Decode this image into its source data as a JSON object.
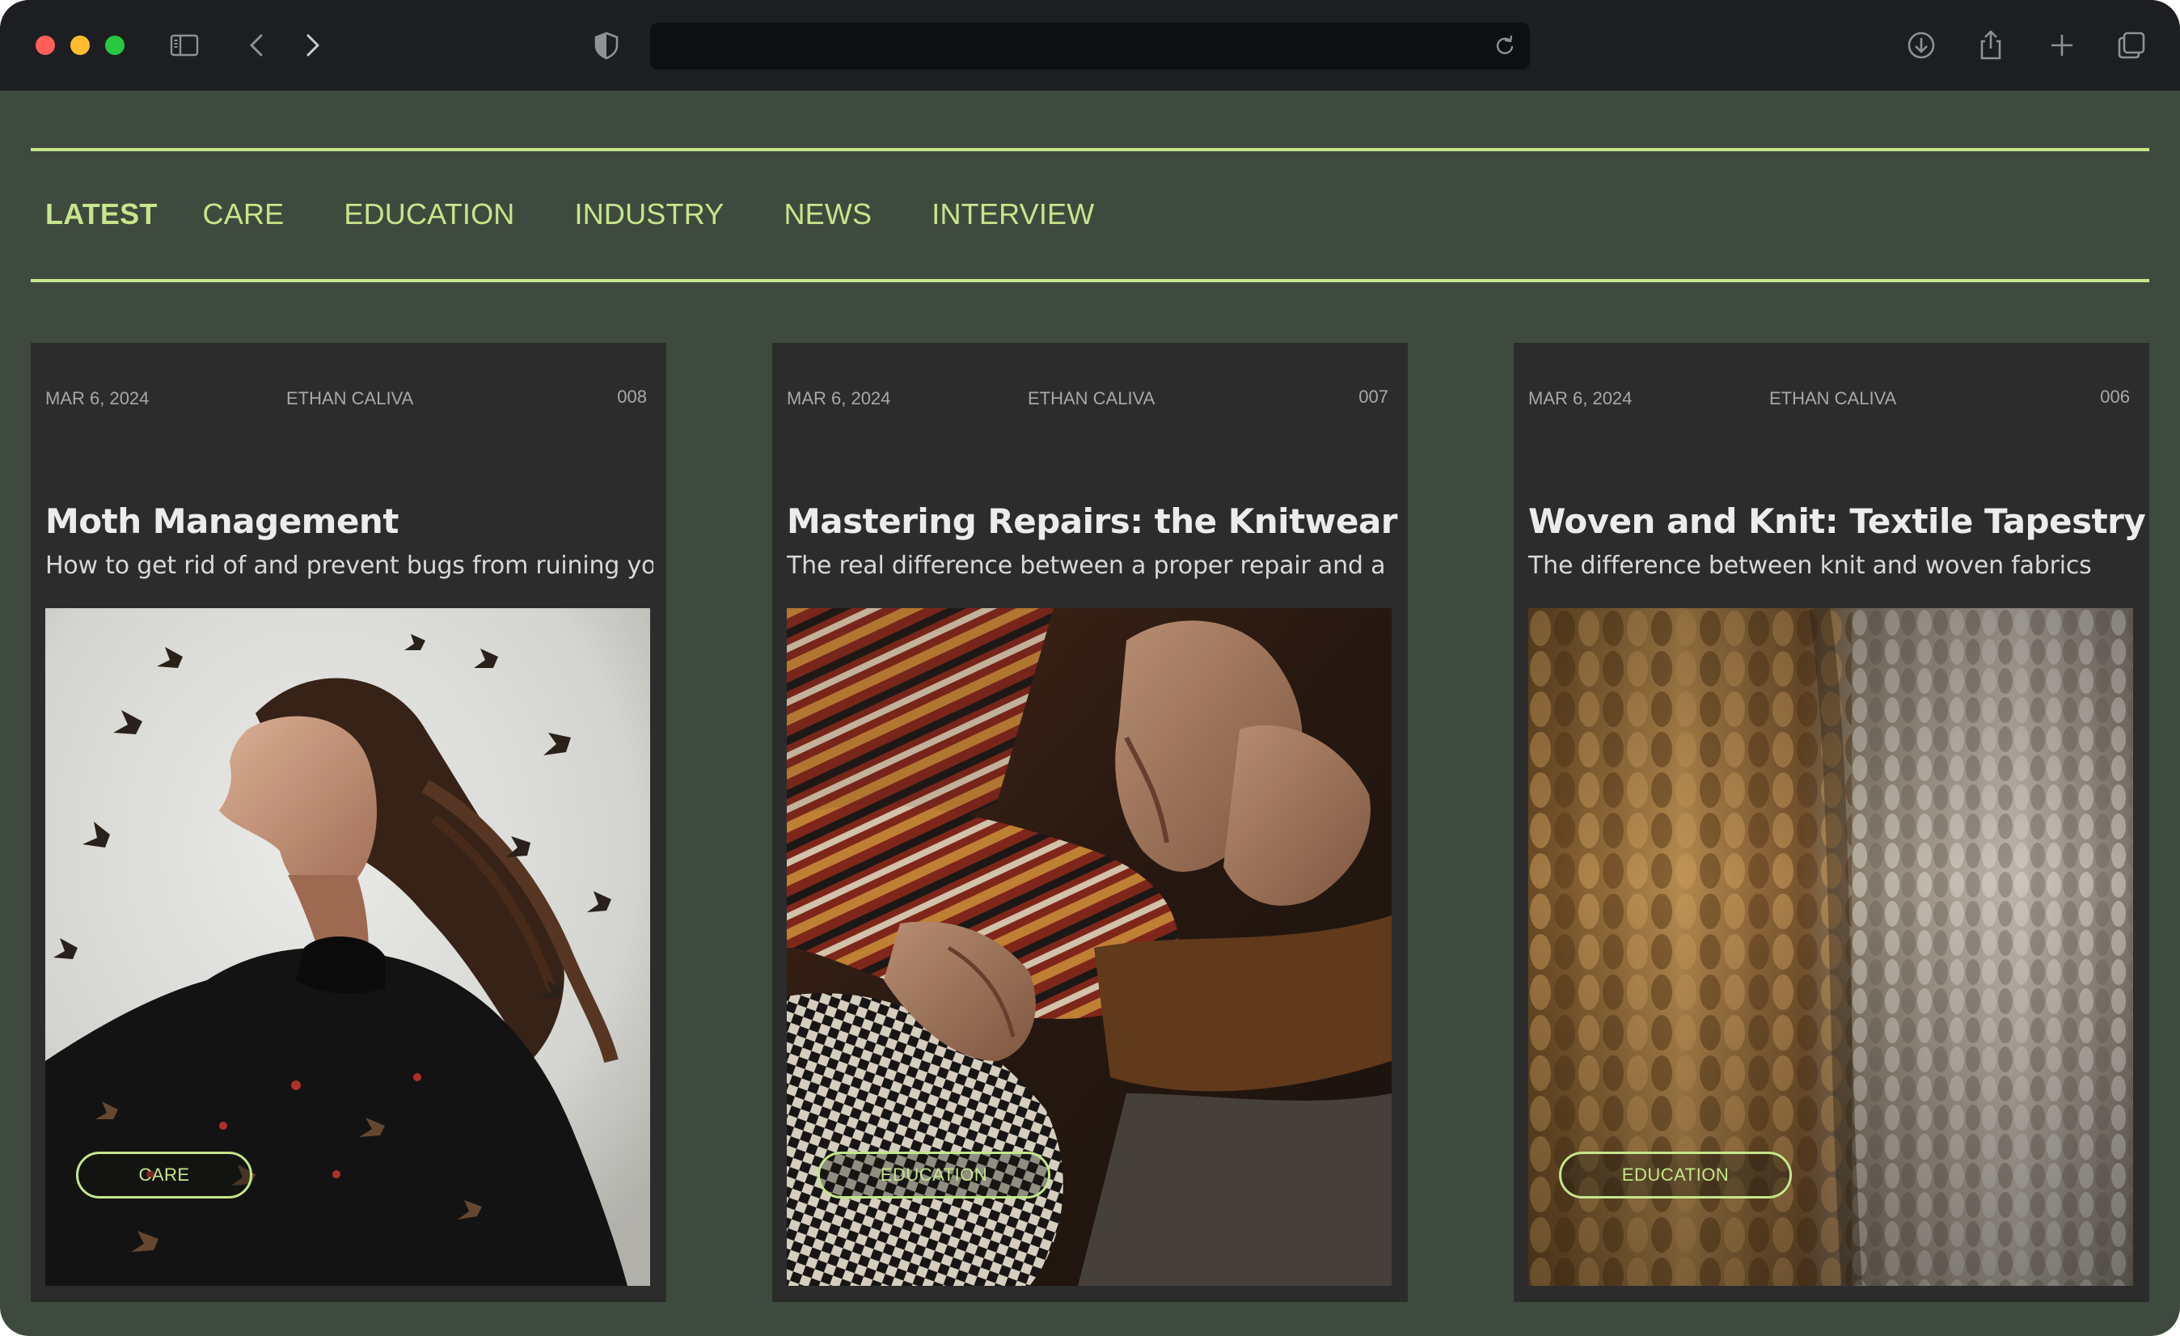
{
  "browser": {
    "url": "",
    "icons": [
      "sidebar-icon",
      "back-icon",
      "forward-icon",
      "shield-icon",
      "reload-icon",
      "download-icon",
      "share-icon",
      "new-tab-icon",
      "tabs-overview-icon"
    ]
  },
  "theme": {
    "accent": "#c5e68a",
    "page_bg": "#3f4a3e",
    "card_bg": "#2c2c2c"
  },
  "nav": {
    "items": [
      "LATEST",
      "CARE",
      "EDUCATION",
      "INDUSTRY",
      "NEWS",
      "INTERVIEW"
    ],
    "active": "LATEST"
  },
  "cards": [
    {
      "date": "MAR 6, 2024",
      "author": "ETHAN CALIVA",
      "number": "008",
      "title": "Moth Management",
      "excerpt": "How to get rid of and prevent bugs from ruining your",
      "tag": "CARE",
      "image": "woman-with-moths"
    },
    {
      "date": "MAR 6, 2024",
      "author": "ETHAN CALIVA",
      "number": "007",
      "title": "Mastering Repairs: the Knitwear",
      "excerpt": "The real difference between a proper repair and a",
      "tag": "EDUCATION",
      "image": "hands-repairing-knitwear"
    },
    {
      "date": "MAR 6, 2024",
      "author": "ETHAN CALIVA",
      "number": "006",
      "title": "Woven and Knit: Textile Tapestry",
      "excerpt": "The difference between knit and woven fabrics",
      "tag": "EDUCATION",
      "image": "knit-fabric-closeup"
    }
  ]
}
